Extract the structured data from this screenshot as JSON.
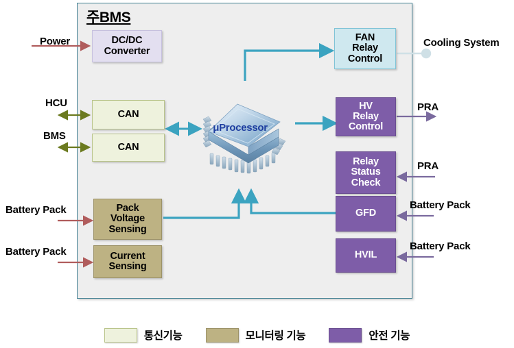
{
  "diagram": {
    "title": "주BMS",
    "container_border_color": "#3f7f92",
    "container_fill_color": "#eeeeee"
  },
  "nodes": {
    "dcdc": {
      "label": "DC/DC\nConverter",
      "color": "#e3dff0",
      "category": "power"
    },
    "can_hcu": {
      "label": "CAN",
      "color": "#eef2dd",
      "category": "communication"
    },
    "can_bms": {
      "label": "CAN",
      "color": "#eef2dd",
      "category": "communication"
    },
    "pack_voltage": {
      "label": "Pack\nVoltage\nSensing",
      "color": "#bdb283",
      "category": "monitoring"
    },
    "current_sensing": {
      "label": "Current\nSensing",
      "color": "#bdb283",
      "category": "monitoring"
    },
    "processor": {
      "label": "μProcessor",
      "color": "#1f3fa0",
      "category": "core"
    },
    "fan_relay": {
      "label": "FAN\nRelay\nControl",
      "color": "#cfe8ef",
      "category": "control"
    },
    "hv_relay": {
      "label": "HV\nRelay\nControl",
      "color": "#7e5da8",
      "category": "safety"
    },
    "relay_status": {
      "label": "Relay\nStatus\nCheck",
      "color": "#7e5da8",
      "category": "safety"
    },
    "gfd": {
      "label": "GFD",
      "color": "#7e5da8",
      "category": "safety"
    },
    "hvil": {
      "label": "HVIL",
      "color": "#7e5da8",
      "category": "safety"
    }
  },
  "external_labels": {
    "power": "Power",
    "hcu": "HCU",
    "bms": "BMS",
    "battery_pack_voltage": "Battery Pack",
    "battery_pack_current": "Battery Pack",
    "cooling_system": "Cooling System",
    "pra_hv": "PRA",
    "pra_status": "PRA",
    "battery_pack_gfd": "Battery Pack",
    "battery_pack_hvil": "Battery Pack"
  },
  "legend": {
    "items": [
      {
        "label": "통신기능",
        "color": "#eef2dd",
        "border": "#b9c48a"
      },
      {
        "label": "모니터링 기능",
        "color": "#bdb283",
        "border": "#9c9268"
      },
      {
        "label": "안전 기능",
        "color": "#7e5da8",
        "border": "#6a4e90"
      }
    ]
  },
  "arrow_colors": {
    "power_red": "#b05c5c",
    "can_green": "#6b7a1f",
    "internal_cyan": "#3ba3c0",
    "safety_purple": "#7a6a9e",
    "cooling_gray": "#b9cdd4"
  }
}
